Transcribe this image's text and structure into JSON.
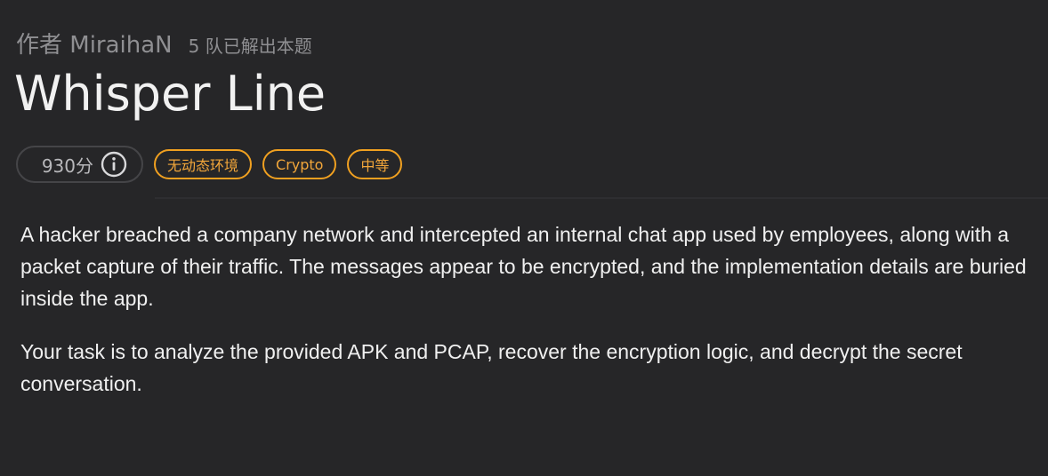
{
  "header": {
    "author": "作者 MiraihaN",
    "solves": "5 队已解出本题",
    "title": "Whisper Line"
  },
  "tags": {
    "score": "930分",
    "info_icon": "info-icon",
    "environment": "无动态环境",
    "category": "Crypto",
    "difficulty": "中等"
  },
  "description": {
    "paragraph1": "A hacker breached a company network and intercepted an internal chat app used by employees, along with a packet capture of their traffic. The messages appear to be encrypted, and the implementation details are buried inside the app.",
    "paragraph2": "Your task is to analyze the provided APK and PCAP, recover the encryption logic, and decrypt the secret conversation."
  },
  "colors": {
    "background": "#262628",
    "accent": "#f0a020",
    "muted": "#8f8f92"
  }
}
